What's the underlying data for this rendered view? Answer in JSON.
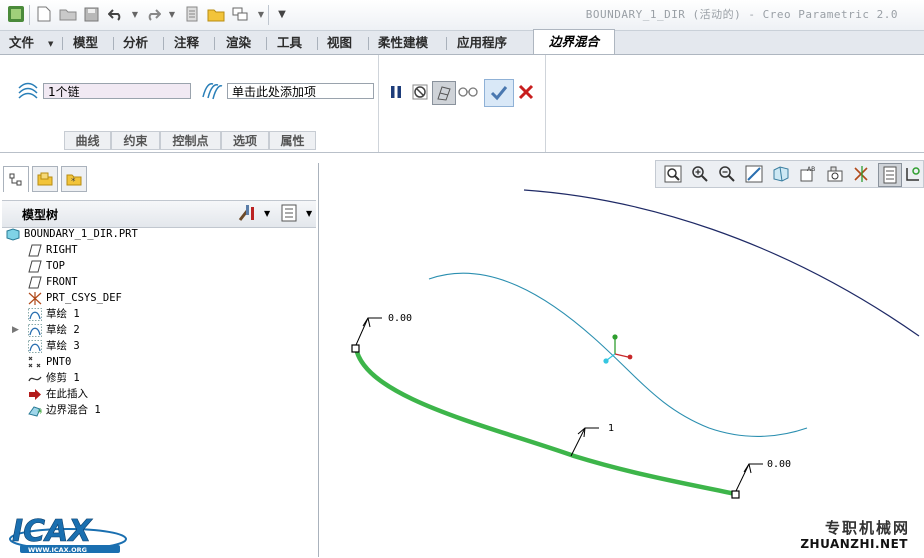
{
  "window": {
    "title": "BOUNDARY_1_DIR (活动的) - Creo Parametric 2.0"
  },
  "menu": {
    "tabs": [
      "文件",
      "模型",
      "分析",
      "注释",
      "渲染",
      "工具",
      "视图",
      "柔性建模",
      "应用程序"
    ],
    "active_tab": "边界混合"
  },
  "ribbon": {
    "first_direction_value": "1个链",
    "second_direction_placeholder": "单击此处添加项",
    "subtabs": [
      "曲线",
      "约束",
      "控制点",
      "选项",
      "属性"
    ]
  },
  "model_tree": {
    "title": "模型树",
    "items": [
      {
        "label": "BOUNDARY_1_DIR.PRT",
        "icon": "part-icon",
        "expandable": false
      },
      {
        "label": "RIGHT",
        "icon": "datum-plane-icon",
        "expandable": false
      },
      {
        "label": "TOP",
        "icon": "datum-plane-icon",
        "expandable": false
      },
      {
        "label": "FRONT",
        "icon": "datum-plane-icon",
        "expandable": false
      },
      {
        "label": "PRT_CSYS_DEF",
        "icon": "csys-icon",
        "expandable": false
      },
      {
        "label": "草绘 1",
        "icon": "sketch-icon",
        "expandable": false
      },
      {
        "label": "草绘 2",
        "icon": "sketch-icon",
        "expandable": true
      },
      {
        "label": "草绘 3",
        "icon": "sketch-icon",
        "expandable": false
      },
      {
        "label": "PNT0",
        "icon": "datum-point-icon",
        "expandable": false
      },
      {
        "label": "修剪 1",
        "icon": "trim-icon",
        "expandable": false
      },
      {
        "label": "在此插入",
        "icon": "insert-here-icon",
        "expandable": false
      },
      {
        "label": "边界混合 1",
        "icon": "boundary-blend-icon",
        "expandable": false
      }
    ]
  },
  "viewport": {
    "labels": {
      "start": "0.00",
      "end": "0.00",
      "chain": "1"
    },
    "colors": {
      "upper_curve": "#1f2a66",
      "middle_curve": "#2b8fb0",
      "selected_chain": "#3db54a"
    }
  },
  "watermarks": {
    "logo_text": "ICAX",
    "logo_url": "WWW.ICAX.ORG",
    "site_cn": "专职机械网",
    "site_en": "ZHUANZHI.NET"
  }
}
